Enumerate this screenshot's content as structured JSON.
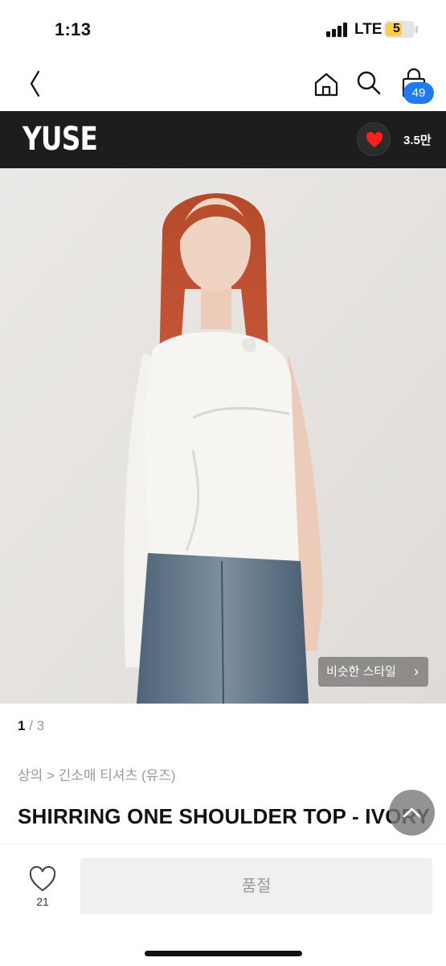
{
  "status_bar": {
    "time": "1:13",
    "network": "LTE",
    "battery_level": "5"
  },
  "nav": {
    "icons": [
      "chevron-left-icon",
      "home-icon",
      "search-icon",
      "shopping-bag-icon"
    ],
    "cart_count": "49"
  },
  "brand": {
    "name": "YUSE",
    "like_count": "3.5만",
    "accent": "#ff1f1f"
  },
  "gallery": {
    "similar_style_label": "비슷한 스타일",
    "page_current": "1",
    "page_total": "3"
  },
  "breadcrumb": "상의 > 긴소매 티셔츠 (유즈)",
  "product": {
    "title": "SHIRRING ONE SHOULDER TOP - IVORY"
  },
  "bottom_bar": {
    "wish_count": "21",
    "status_label": "품절",
    "badge_color": "#1e7cf0"
  }
}
